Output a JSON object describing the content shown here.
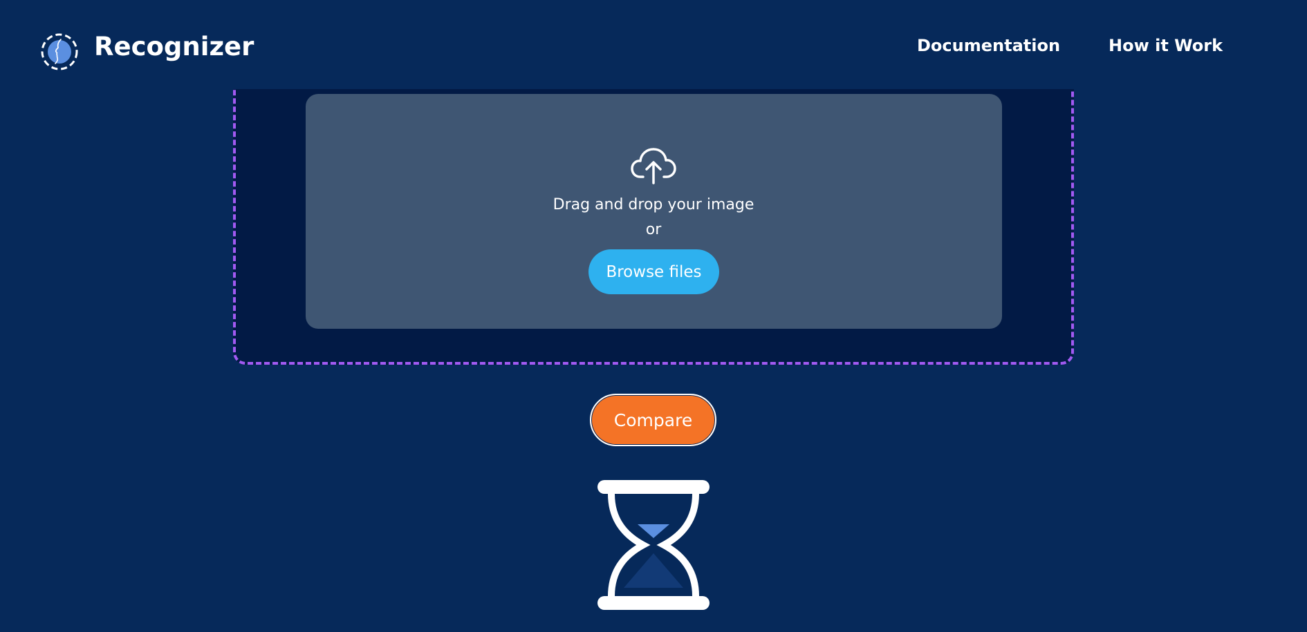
{
  "header": {
    "brand": "Recognizer",
    "nav": [
      {
        "label": "Documentation"
      },
      {
        "label": "How it Work"
      }
    ]
  },
  "upload": {
    "drag_text": "Drag and drop your image",
    "or_text": "or",
    "browse_label": "Browse files",
    "icon": "cloud-upload-icon"
  },
  "actions": {
    "compare_label": "Compare"
  },
  "status": {
    "icon": "hourglass-icon"
  },
  "colors": {
    "background": "#06295a",
    "dropzone_border": "#a25af2",
    "dropzone_bg": "#021a45",
    "dropzone_inner": "#3f5673",
    "browse_button": "#2eb1ef",
    "compare_button": "#f47326"
  }
}
